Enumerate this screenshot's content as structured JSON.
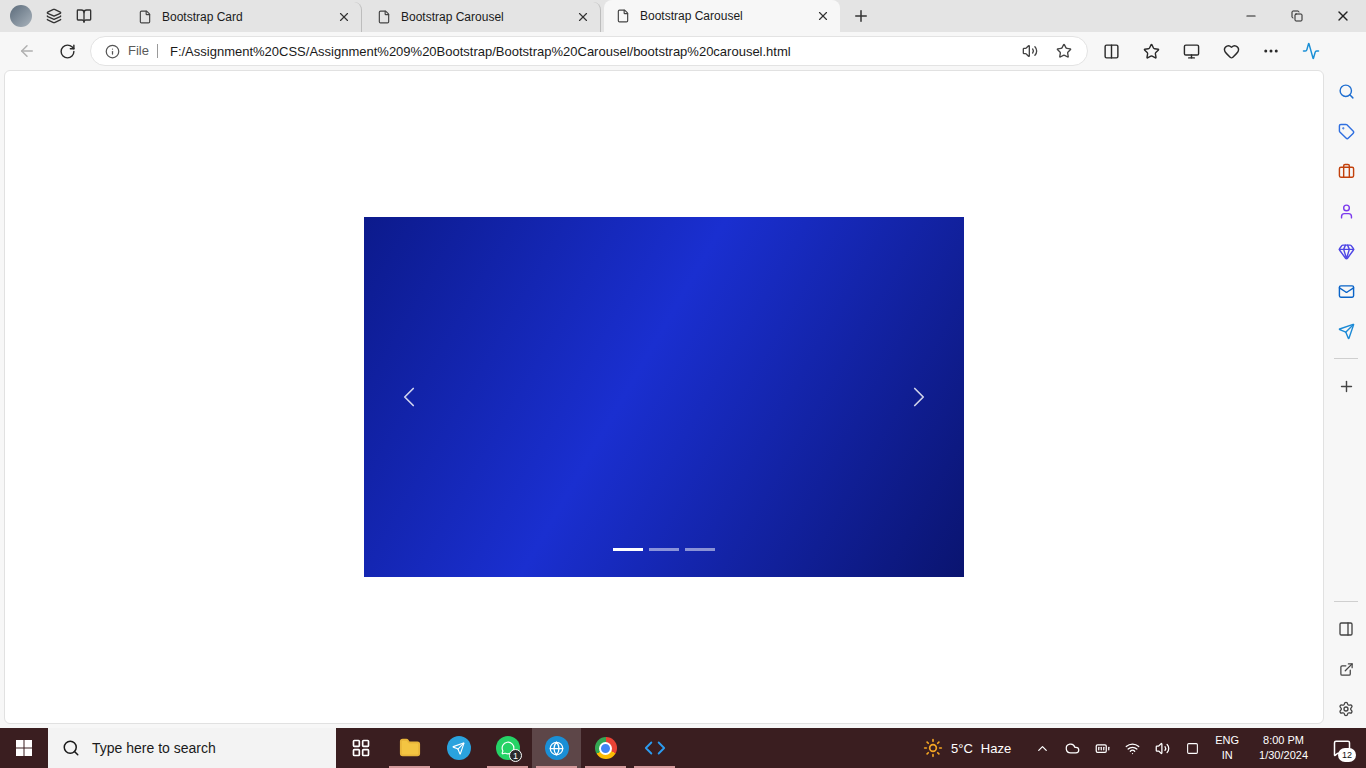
{
  "browser": {
    "tabs": [
      {
        "label": "Bootstrap Card",
        "selected": false
      },
      {
        "label": "Bootstrap Carousel",
        "selected": false
      },
      {
        "label": "Bootstrap Carousel",
        "selected": true
      }
    ],
    "address": {
      "scheme": "File",
      "url": "F:/Assignment%20CSS/Assignment%209%20Bootstrap/Bootstrap%20Carousel/bootstrap%20carousel.html"
    }
  },
  "carousel": {
    "slides": [
      {
        "selected": true
      },
      {
        "selected": false
      },
      {
        "selected": false
      }
    ]
  },
  "taskbar": {
    "search": {
      "placeholder": "Type here to search"
    },
    "apps": [
      {
        "kind": "task-view",
        "running": false,
        "selected": false
      },
      {
        "kind": "file-explorer",
        "running": true,
        "selected": false
      },
      {
        "kind": "telegram",
        "running": false,
        "selected": false
      },
      {
        "kind": "whatsapp",
        "running": true,
        "selected": false
      },
      {
        "kind": "edge",
        "running": true,
        "selected": true
      },
      {
        "kind": "chrome",
        "running": true,
        "selected": false
      },
      {
        "kind": "vscode",
        "running": true,
        "selected": false
      }
    ],
    "whatsapp_badge": "1",
    "weather": {
      "temperature": "5°C",
      "condition": "Haze"
    },
    "language": {
      "code": "ENG",
      "region": "IN"
    },
    "clock": {
      "time": "8:00 PM",
      "date": "1/30/2024"
    },
    "notifications": "12"
  }
}
